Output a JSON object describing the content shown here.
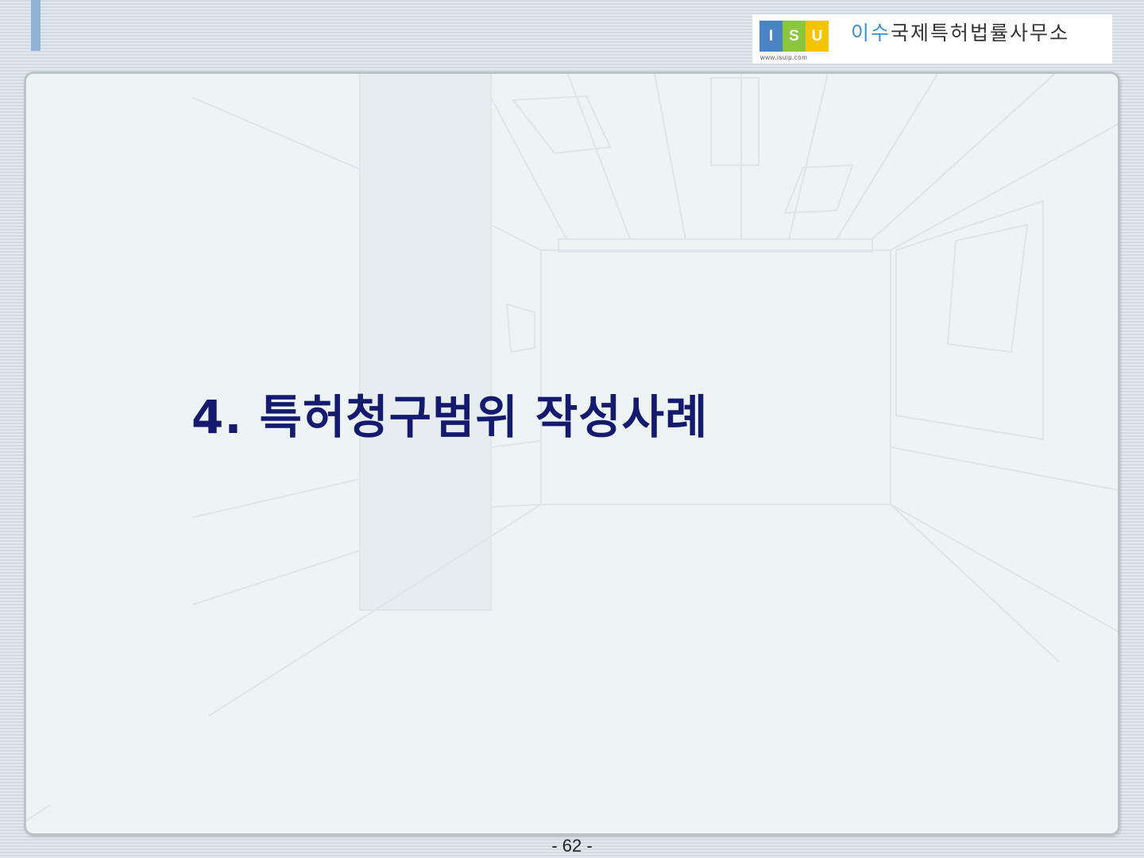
{
  "logo": {
    "letters": [
      "I",
      "S",
      "U"
    ],
    "letter_colors": [
      "#4a84c4",
      "#8cc63f",
      "#f5c400"
    ],
    "url": "www.isuip.com",
    "name_highlight": "이수",
    "name_rest": "국제특허법률사무소"
  },
  "slide": {
    "title": "4. 특허청구범위 작성사례"
  },
  "footer": {
    "page_number": "- 62 -"
  },
  "colors": {
    "title": "#141a6e",
    "accent_bar": "#8fb3d3",
    "panel_background": "#eef3f6"
  }
}
